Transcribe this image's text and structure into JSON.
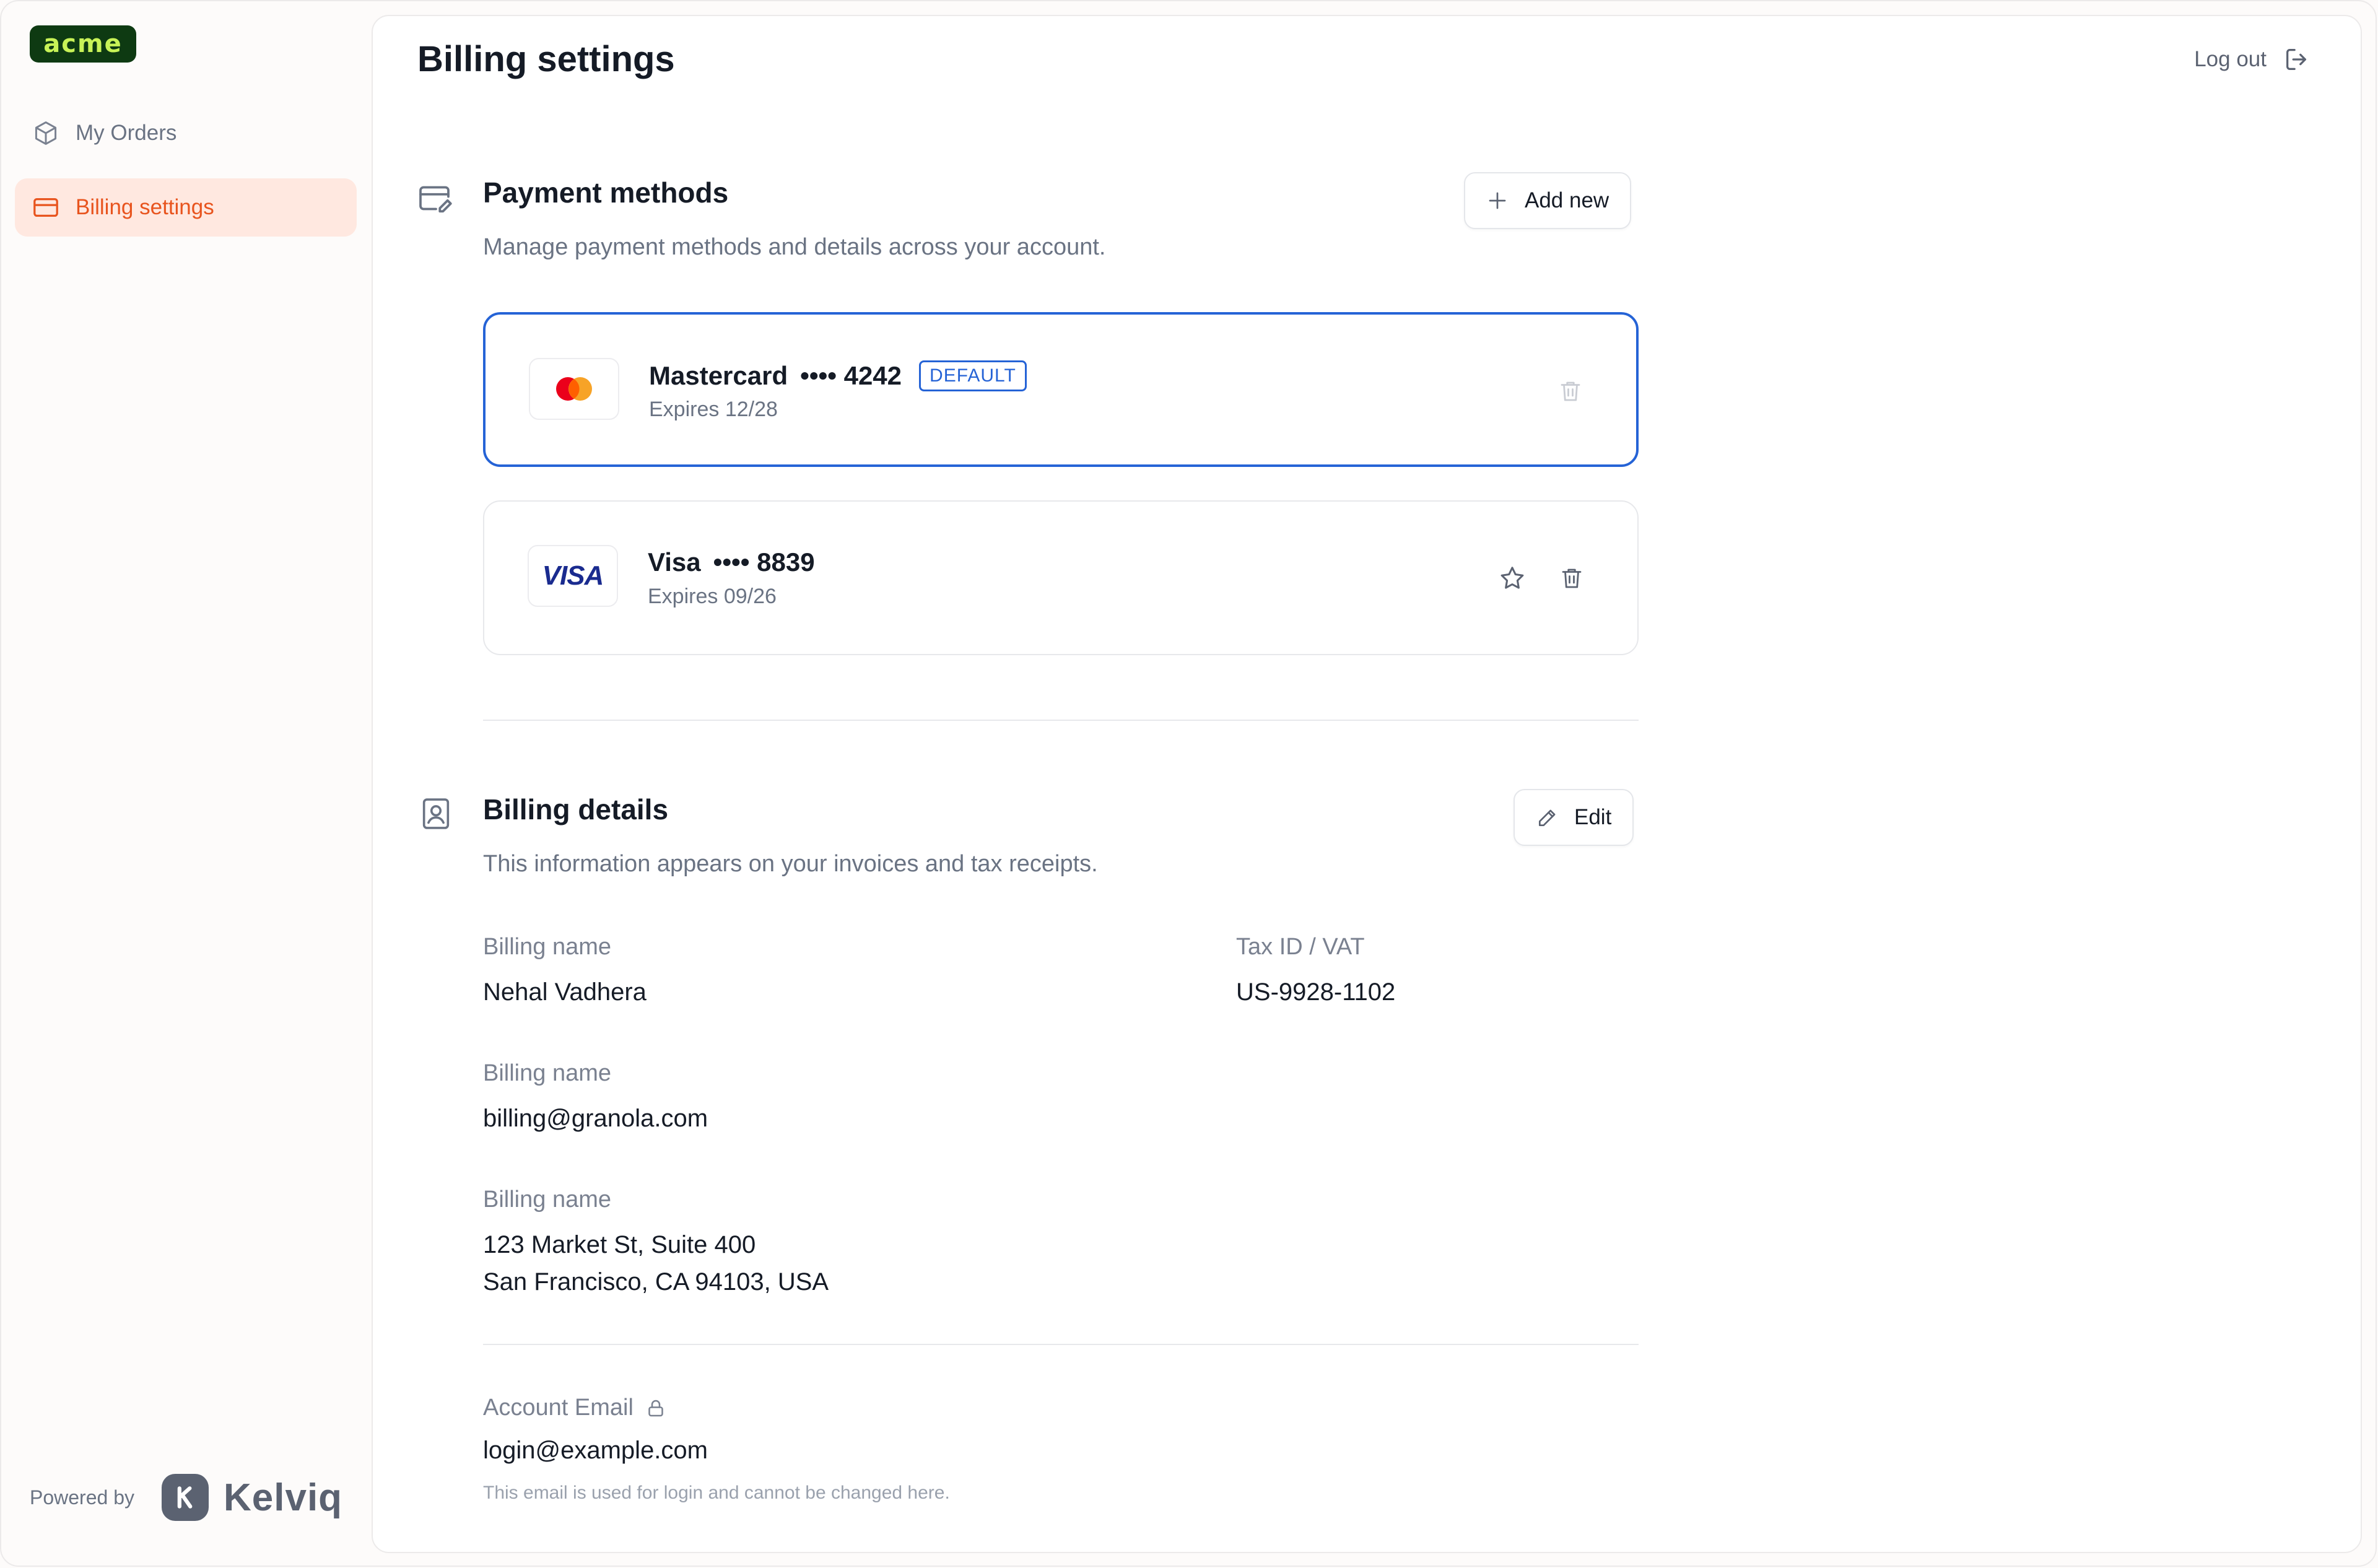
{
  "sidebar": {
    "logo_text": "acme",
    "items": [
      {
        "label": "My Orders",
        "icon": "box-icon",
        "active": false
      },
      {
        "label": "Billing settings",
        "icon": "credit-card-icon",
        "active": true
      }
    ],
    "powered_by": "Powered by",
    "vendor_name": "Kelviq"
  },
  "header": {
    "title": "Billing settings",
    "logout_label": "Log out"
  },
  "payment_methods": {
    "title": "Payment methods",
    "description": "Manage payment methods and details across your account.",
    "add_label": "Add new",
    "cards": [
      {
        "brand": "Mastercard",
        "masked": "•••• 4242",
        "expires": "Expires 12/28",
        "badge": "DEFAULT"
      },
      {
        "brand": "Visa",
        "masked": "•••• 8839",
        "expires": "Expires 09/26",
        "brand_mark": "VISA"
      }
    ]
  },
  "billing_details": {
    "title": "Billing details",
    "description": "This information appears on your invoices and tax receipts.",
    "edit_label": "Edit",
    "name_label": "Billing name",
    "name_value": "Nehal Vadhera",
    "tax_label": "Tax ID / VAT",
    "tax_value": "US-9928-1102",
    "email_label": "Billing name",
    "email_value": "billing@granola.com",
    "address_label": "Billing name",
    "address_line1": "123 Market St, Suite 400",
    "address_line2": "San Francisco, CA 94103, USA"
  },
  "account": {
    "email_label": "Account Email",
    "email_value": "login@example.com",
    "note": "This email is used for login and cannot be changed here."
  },
  "colors": {
    "accent": "#e8541e",
    "active_bg": "#ffe8e0",
    "default_border": "#2563d6",
    "logo_bg": "#0e3a12",
    "logo_text": "#c8f257"
  }
}
